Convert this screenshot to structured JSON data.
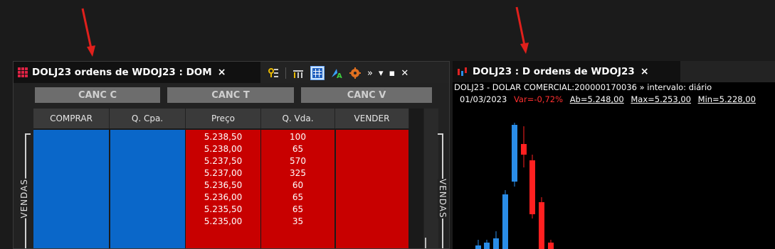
{
  "dom_panel": {
    "tab_title": "DOLJ23 ordens de WDOJ23 : DOM",
    "tab_close": "×",
    "toolbar_icons": [
      "filter-icon",
      "columns-icon",
      "grid-icon",
      "font-color-icon",
      "settings-icon",
      "overflow-icon",
      "dropdown-icon",
      "maximize-icon",
      "close-icon"
    ],
    "toolbar_overflow": "»",
    "toolbar_dropdown": "▾",
    "toolbar_maximize": "▪",
    "toolbar_close": "✕",
    "buttons": {
      "canc_c": "CANC C",
      "canc_t": "CANC T",
      "canc_v": "CANC V"
    },
    "columns": [
      "COMPRAR",
      "Q. Cpa.",
      "Preço",
      "Q. Vda.",
      "VENDER"
    ],
    "rows": [
      {
        "price": "5.238,50",
        "qty": "100"
      },
      {
        "price": "5.238,00",
        "qty": "65"
      },
      {
        "price": "5.237,50",
        "qty": "570"
      },
      {
        "price": "5.237,00",
        "qty": "325"
      },
      {
        "price": "5.236,50",
        "qty": "60"
      },
      {
        "price": "5.236,00",
        "qty": "65"
      },
      {
        "price": "5.235,50",
        "qty": "65"
      },
      {
        "price": "5.235,00",
        "qty": "35"
      }
    ],
    "side_label_left": "VENDAS",
    "side_label_right": "VENDAS"
  },
  "chart_panel": {
    "tab_title": "DOLJ23 : D ordens de WDOJ23",
    "tab_close": "×",
    "info_line": "DOLJ23 - DOLAR COMERCIAL:200000170036 » intervalo: diário",
    "date": "01/03/2023",
    "var": "Var=-0,72%",
    "ab": "Ab=5.248,00",
    "max": "Max=5.253,00",
    "min": "Min=5.228,00"
  },
  "colors": {
    "buy_blue": "#0a67c9",
    "sell_red": "#c80000",
    "arrow_red": "#e0201c"
  }
}
